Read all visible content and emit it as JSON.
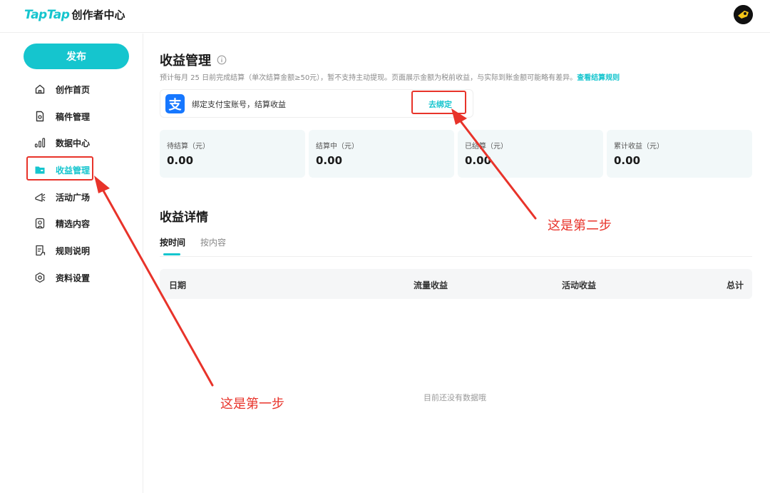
{
  "header": {
    "logo_brand": "TapTap",
    "logo_sub": "创作者中心"
  },
  "sidebar": {
    "publish_label": "发布",
    "items": [
      {
        "label": "创作首页",
        "icon": "home-icon"
      },
      {
        "label": "稿件管理",
        "icon": "document-icon"
      },
      {
        "label": "数据中心",
        "icon": "bar-chart-icon"
      },
      {
        "label": "收益管理",
        "icon": "folder-icon",
        "active": true
      },
      {
        "label": "活动广场",
        "icon": "megaphone-icon"
      },
      {
        "label": "精选内容",
        "icon": "badge-icon"
      },
      {
        "label": "规则说明",
        "icon": "rules-icon"
      },
      {
        "label": "资料设置",
        "icon": "settings-icon"
      }
    ]
  },
  "main": {
    "title": "收益管理",
    "note_text": "预计每月 25 日前完成结算（单次结算金额≥50元），暂不支持主动提现。页面展示金额为税前收益，与实际到账金额可能略有差异。",
    "note_link": "查看结算规则",
    "bind": {
      "icon_glyph": "支",
      "text": "绑定支付宝账号，结算收益",
      "action": "去绑定"
    },
    "stats": [
      {
        "label": "待结算（元）",
        "value": "0.00"
      },
      {
        "label": "结算中（元）",
        "value": "0.00"
      },
      {
        "label": "已结算（元）",
        "value": "0.00"
      },
      {
        "label": "累计收益（元）",
        "value": "0.00"
      }
    ],
    "details_title": "收益详情",
    "tabs": [
      "按时间",
      "按内容"
    ],
    "table_headers": [
      "日期",
      "流量收益",
      "活动收益",
      "总计"
    ],
    "empty_text": "目前还没有数据哦"
  },
  "annotations": {
    "step1": "这是第一步",
    "step2": "这是第二步",
    "color": "#e8332a"
  },
  "colors": {
    "accent": "#15c5ce",
    "alipay": "#1677ff"
  }
}
